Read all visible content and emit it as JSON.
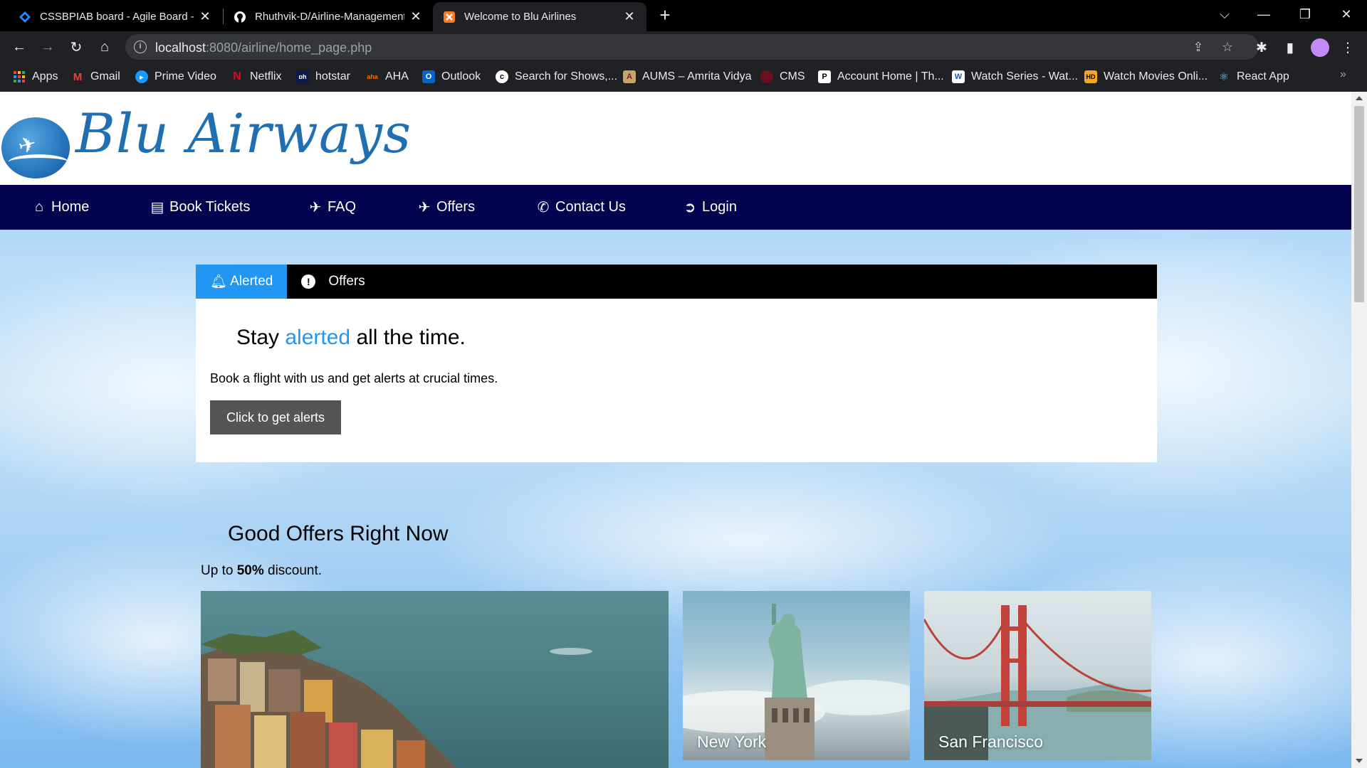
{
  "browser": {
    "tabs": [
      {
        "title": "CSSBPIAB board - Agile Board - A",
        "icon": "jira-icon",
        "active": false
      },
      {
        "title": "Rhuthvik-D/Airline-Management",
        "icon": "github-icon",
        "active": false
      },
      {
        "title": "Welcome to Blu Airlines",
        "icon": "xampp-icon",
        "active": true
      }
    ],
    "new_tab": "+",
    "url_host": "localhost",
    "url_path": ":8080/airline/home_page.php",
    "bookmarks": [
      {
        "label": "Apps",
        "icon": "apps-grid-icon"
      },
      {
        "label": "Gmail",
        "icon": "gmail-icon"
      },
      {
        "label": "Prime Video",
        "icon": "prime-video-icon"
      },
      {
        "label": "Netflix",
        "icon": "netflix-icon"
      },
      {
        "label": "hotstar",
        "icon": "hotstar-icon"
      },
      {
        "label": "AHA",
        "icon": "aha-icon"
      },
      {
        "label": "Outlook",
        "icon": "outlook-icon"
      },
      {
        "label": "Search for Shows,...",
        "icon": "search-shows-icon"
      },
      {
        "label": "AUMS – Amrita Vidya",
        "icon": "aums-icon"
      },
      {
        "label": "CMS",
        "icon": "cms-icon"
      },
      {
        "label": "Account Home | Th...",
        "icon": "account-home-icon"
      },
      {
        "label": "Watch Series - Wat...",
        "icon": "watch-series-icon"
      },
      {
        "label": "Watch Movies Onli...",
        "icon": "watch-movies-icon"
      },
      {
        "label": "React App",
        "icon": "react-icon"
      }
    ]
  },
  "site": {
    "logo_text": "Blu Airways",
    "nav": [
      {
        "label": "Home",
        "icon": "home-icon"
      },
      {
        "label": "Book Tickets",
        "icon": "ticket-icon"
      },
      {
        "label": "FAQ",
        "icon": "plane-icon"
      },
      {
        "label": "Offers",
        "icon": "plane-icon"
      },
      {
        "label": "Contact Us",
        "icon": "phone-icon"
      },
      {
        "label": "Login",
        "icon": "sign-in-icon"
      }
    ],
    "tabs": [
      {
        "label": "Alerted",
        "icon": "bell-icon",
        "active": true
      },
      {
        "label": "Offers",
        "icon": "exclamation-circle-icon",
        "active": false
      }
    ],
    "alert_panel": {
      "heading_pre": "Stay ",
      "heading_highlight": "alerted",
      "heading_post": " all the time.",
      "text": "Book a flight with us and get alerts at crucial times.",
      "button": "Click to get alerts"
    },
    "offers_section": {
      "title": "Good Offers Right Now",
      "sub_pre": "Up to ",
      "sub_bold": "50%",
      "sub_post": " discount.",
      "cards": [
        {
          "caption": ""
        },
        {
          "caption": "New York"
        },
        {
          "caption": "San Francisco"
        }
      ]
    },
    "colors": {
      "nav_bg": "#03034f",
      "accent": "#2196f3",
      "logo": "#1f6fb2",
      "button_bg": "#555555"
    }
  }
}
